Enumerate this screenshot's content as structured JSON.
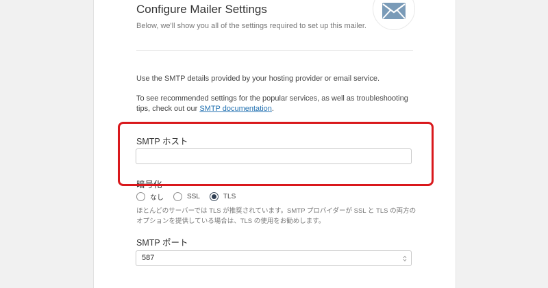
{
  "header": {
    "title": "Configure Mailer Settings",
    "subtitle": "Below, we'll show you all of the settings required to set up this mailer.",
    "icon": "envelope-icon"
  },
  "intro": {
    "line1": "Use the SMTP details provided by your hosting provider or email service.",
    "line2_pre": "To see recommended settings for the popular services, as well as troubleshooting tips, check out our ",
    "link_text": "SMTP documentation",
    "line2_post": "."
  },
  "smtp_host": {
    "label": "SMTP ホスト",
    "value": "",
    "placeholder": ""
  },
  "encryption": {
    "label": "暗号化",
    "options": [
      "なし",
      "SSL",
      "TLS"
    ],
    "selected": "TLS",
    "help": "ほとんどのサーバーでは TLS が推奨されています。SMTP プロバイダーが SSL と TLS の両方のオプションを提供している場合は、TLS の使用をお勧めします。"
  },
  "smtp_port": {
    "label": "SMTP ポート",
    "value": "587"
  },
  "colors": {
    "highlight": "#d9181c",
    "link": "#2271b1",
    "envelope": "#7a9bb8"
  }
}
